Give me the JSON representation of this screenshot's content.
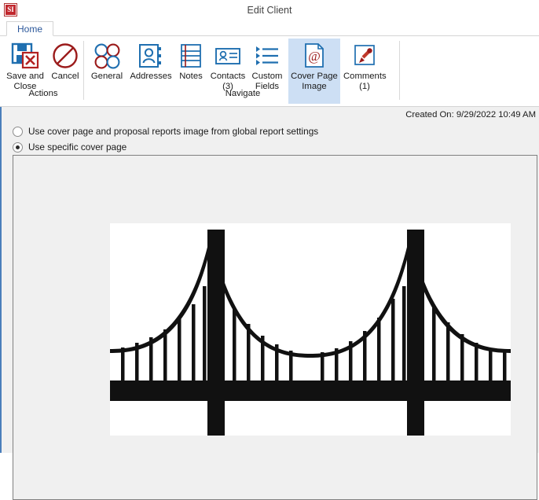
{
  "window": {
    "title": "Edit Client",
    "logo_text": "SI",
    "logo_name": "si-app-logo"
  },
  "tabs": [
    {
      "label": "Home",
      "selected": true
    }
  ],
  "ribbon": {
    "groups": [
      {
        "label": "Actions",
        "buttons": [
          {
            "label": "Save and Close",
            "icon": "save-and-close-icon",
            "selected": false
          },
          {
            "label": "Cancel",
            "icon": "cancel-icon",
            "selected": false
          }
        ]
      },
      {
        "label": "Navigate",
        "buttons": [
          {
            "label": "General",
            "icon": "general-circles-icon",
            "selected": false
          },
          {
            "label": "Addresses",
            "icon": "address-book-icon",
            "selected": false
          },
          {
            "label": "Notes",
            "icon": "notes-icon",
            "selected": false
          },
          {
            "label": "Contacts (3)",
            "icon": "contacts-card-icon",
            "selected": false
          },
          {
            "label": "Custom Fields",
            "icon": "custom-fields-list-icon",
            "selected": false
          },
          {
            "label": "Cover Page Image",
            "icon": "cover-page-image-icon",
            "selected": true
          },
          {
            "label": "Comments (1)",
            "icon": "comments-pin-icon",
            "selected": false
          }
        ]
      }
    ]
  },
  "main": {
    "created_on": "Created On: 9/29/2022 10:49 AM",
    "options": [
      {
        "label": "Use cover page and proposal reports image from global report settings",
        "selected": false
      },
      {
        "label": "Use specific cover page",
        "selected": true
      }
    ],
    "cover_image": {
      "alt": "suspension-bridge-silhouette"
    }
  },
  "colors": {
    "accent_blue": "#2b579a",
    "selected_ribbon": "#cddff4",
    "icon_blue": "#1f6fb0",
    "icon_red": "#9b1b1b",
    "panel_bg": "#f0f0f0",
    "left_border": "#4a7ebb"
  }
}
